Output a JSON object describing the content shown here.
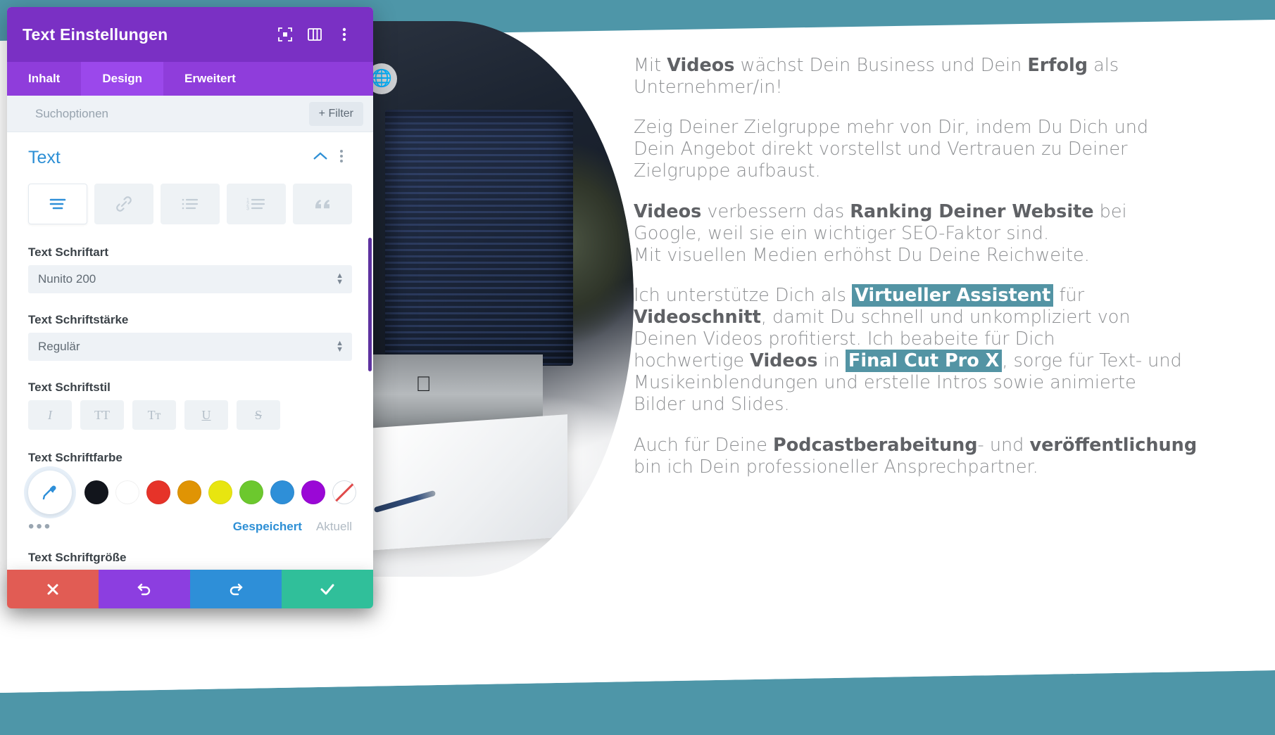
{
  "modal": {
    "title": "Text Einstellungen",
    "header_icons": [
      {
        "name": "focus-target-icon",
        "label": "Fokus"
      },
      {
        "name": "layout-panel-icon",
        "label": "Layout"
      },
      {
        "name": "more-vertical-icon",
        "label": "Mehr"
      }
    ],
    "tabs": [
      {
        "label": "Inhalt",
        "active": false
      },
      {
        "label": "Design",
        "active": true
      },
      {
        "label": "Erweitert",
        "active": false
      }
    ],
    "search": {
      "placeholder": "Suchoptionen",
      "value": "",
      "filter_label": "+ Filter"
    },
    "section": {
      "title": "Text",
      "collapse_icon": "chevron-up-icon",
      "menu_icon": "more-vertical-icon"
    },
    "text_type_tabs": [
      {
        "name": "paragraph-text-icon",
        "label": "Text",
        "active": true
      },
      {
        "name": "link-icon",
        "label": "Link",
        "active": false
      },
      {
        "name": "unordered-list-icon",
        "label": "Ungeordnete Liste",
        "active": false
      },
      {
        "name": "ordered-list-icon",
        "label": "Geordnete Liste",
        "active": false
      },
      {
        "name": "blockquote-icon",
        "label": "Zitat",
        "active": false
      }
    ],
    "fields": {
      "font_family": {
        "label": "Text Schriftart",
        "value": "Nunito 200"
      },
      "font_weight": {
        "label": "Text Schriftstärke",
        "value": "Regulär"
      },
      "font_style": {
        "label": "Text Schriftstil",
        "buttons": [
          {
            "name": "italic-icon",
            "glyph": "I"
          },
          {
            "name": "uppercase-icon",
            "glyph": "TT"
          },
          {
            "name": "small-caps-icon",
            "glyph": "Tᴛ"
          },
          {
            "name": "underline-icon",
            "glyph": "U"
          },
          {
            "name": "strikethrough-icon",
            "glyph": "S"
          }
        ]
      },
      "font_color": {
        "label": "Text Schriftfarbe",
        "picker_icon": "eyedropper-icon",
        "swatches": [
          {
            "name": "swatch-black",
            "hex": "#12151c"
          },
          {
            "name": "swatch-white",
            "hex": "#ffffff"
          },
          {
            "name": "swatch-red",
            "hex": "#e63329"
          },
          {
            "name": "swatch-orange",
            "hex": "#e09404"
          },
          {
            "name": "swatch-yellow",
            "hex": "#e8e510"
          },
          {
            "name": "swatch-green",
            "hex": "#6cc82e"
          },
          {
            "name": "swatch-blue",
            "hex": "#2e8fd8"
          },
          {
            "name": "swatch-purple",
            "hex": "#9a08d6"
          },
          {
            "name": "swatch-none",
            "hex": "transparent"
          }
        ],
        "saved_label": "Gespeichert",
        "current_label": "Aktuell"
      },
      "next_field_label": "Text Schriftgröße"
    },
    "actions": [
      {
        "name": "cancel-button",
        "icon": "close-icon",
        "color": "#e15c54"
      },
      {
        "name": "undo-button",
        "icon": "undo-icon",
        "color": "#8c3ee0"
      },
      {
        "name": "redo-button",
        "icon": "redo-icon",
        "color": "#2e8fd8"
      },
      {
        "name": "save-button",
        "icon": "check-icon",
        "color": "#30bf9a"
      }
    ]
  },
  "page": {
    "accent_teal": "#4e96a8",
    "highlight_teal": "#5394a4",
    "globe_icon": "globe-icon",
    "paragraphs": [
      {
        "id": "p1",
        "lines": [
          [
            {
              "t": "Mit ",
              "b": false
            },
            {
              "t": "Videos",
              "b": true
            },
            {
              "t": " wächst Dein Business und Dein ",
              "b": false
            },
            {
              "t": "Erfolg",
              "b": true
            },
            {
              "t": " als",
              "b": false
            }
          ],
          [
            {
              "t": "Unternehmer/in!",
              "b": false
            }
          ]
        ]
      },
      {
        "id": "p2",
        "lines": [
          [
            {
              "t": "Zeig Deiner Zielgruppe mehr von Dir, indem Du Dich und",
              "b": false
            }
          ],
          [
            {
              "t": "Dein Angebot direkt vorstellst und Vertrauen zu Deiner",
              "b": false
            }
          ],
          [
            {
              "t": "Zielgruppe aufbaust.",
              "b": false
            }
          ]
        ]
      },
      {
        "id": "p3",
        "lines": [
          [
            {
              "t": "Videos",
              "b": true
            },
            {
              "t": " verbessern das ",
              "b": false
            },
            {
              "t": "Ranking Deiner Website",
              "b": true
            },
            {
              "t": " bei",
              "b": false
            }
          ],
          [
            {
              "t": "Google, weil sie ein wichtiger SEO-Faktor sind.",
              "b": false
            }
          ],
          [
            {
              "t": "Mit visuellen Medien erhöhst Du Deine Reichweite.",
              "b": false
            }
          ]
        ]
      },
      {
        "id": "p4",
        "lines": [
          [
            {
              "t": "Ich unterstütze Dich als ",
              "b": false
            },
            {
              "t": "Virtueller Assistent",
              "b": true,
              "hl": true
            },
            {
              "t": " für",
              "b": false
            }
          ],
          [
            {
              "t": "Videoschnitt",
              "b": true
            },
            {
              "t": ", damit Du schnell und unkompliziert von",
              "b": false
            }
          ],
          [
            {
              "t": "Deinen Videos profitierst. Ich beabeite für Dich",
              "b": false
            }
          ],
          [
            {
              "t": "hochwertige ",
              "b": false
            },
            {
              "t": "Videos",
              "b": true
            },
            {
              "t": " in ",
              "b": false
            },
            {
              "t": "Final Cut Pro X",
              "b": true,
              "hl": true
            },
            {
              "t": ", sorge für Text- und",
              "b": false
            }
          ],
          [
            {
              "t": "Musikeinblendungen und erstelle Intros sowie animierte",
              "b": false
            }
          ],
          [
            {
              "t": "Bilder und Slides.",
              "b": false
            }
          ]
        ]
      },
      {
        "id": "p5",
        "lines": [
          [
            {
              "t": "Auch für Deine ",
              "b": false
            },
            {
              "t": "Podcastberabeitung",
              "b": true
            },
            {
              "t": "- und ",
              "b": false
            },
            {
              "t": "veröffentlichung",
              "b": true
            }
          ],
          [
            {
              "t": "bin ich Dein professioneller Ansprechpartner.",
              "b": false
            }
          ]
        ]
      }
    ]
  }
}
